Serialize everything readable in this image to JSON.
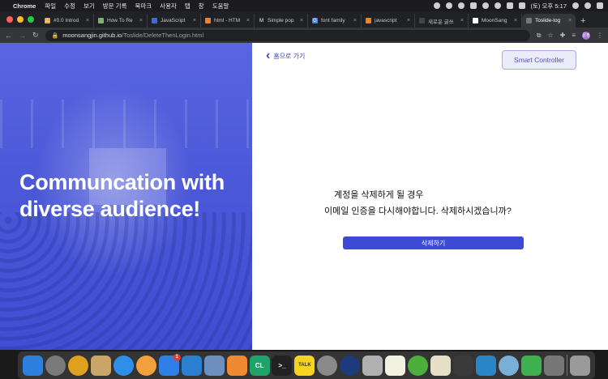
{
  "menubar": {
    "app": "Chrome",
    "items": [
      "파일",
      "수정",
      "보기",
      "방문 기록",
      "북마크",
      "사용자",
      "탭",
      "창",
      "도움말"
    ],
    "clock": "(토) 오후 5:17"
  },
  "tabs": [
    {
      "label": "#0.0 Introd",
      "color": "#f3a33a",
      "glyph": "⚠"
    },
    {
      "label": "How To Re",
      "color": "#7fb26b",
      "glyph": ""
    },
    {
      "label": "JavaScript",
      "color": "#3a6bd8",
      "glyph": ""
    },
    {
      "label": "html - HTM",
      "color": "#f48024",
      "glyph": ""
    },
    {
      "label": "Simple pop",
      "color": "#222222",
      "glyph": "M"
    },
    {
      "label": "font family",
      "color": "#4285f4",
      "glyph": "G"
    },
    {
      "label": "javascript",
      "color": "#f48024",
      "glyph": ""
    },
    {
      "label": "새로운 글쓰",
      "color": "#444444",
      "glyph": ""
    },
    {
      "label": "MoonSang",
      "color": "#ffffff",
      "glyph": ""
    },
    {
      "label": "Toslide-log",
      "color": "#777777",
      "glyph": ""
    }
  ],
  "address": {
    "host": "moonsangjin.github.io",
    "path": "/Toslide/DeleteThenLogin.html"
  },
  "profile_initials": "문정",
  "hero": {
    "title": "Communcation with diverse audience!"
  },
  "nav": {
    "back_label": "홈으로 가기",
    "smart_controller": "Smart Controller"
  },
  "message": {
    "line1": "계정을 삭제하게 될 경우",
    "line2": "이메일 인증을 다시해야합니다. 삭제하시겠습니까?"
  },
  "delete_button": "삭제하기",
  "dock": {
    "apps": [
      {
        "name": "finder-icon",
        "color": "#2d7fe0",
        "round": false
      },
      {
        "name": "launchpad-icon",
        "color": "#7a7a7a",
        "round": true
      },
      {
        "name": "chrome-icon",
        "color": "#e0a020",
        "round": true
      },
      {
        "name": "notes-icon",
        "color": "#c9a56a",
        "round": false
      },
      {
        "name": "safari-icon",
        "color": "#2f8fe8",
        "round": true
      },
      {
        "name": "photos-icon",
        "color": "#f0a03c",
        "round": true
      },
      {
        "name": "app-store-icon",
        "color": "#2f7fe8",
        "round": false,
        "badge": "1"
      },
      {
        "name": "vscode-icon",
        "color": "#2a7fd0",
        "round": false
      },
      {
        "name": "preview-icon",
        "color": "#6d8fc0",
        "round": false
      },
      {
        "name": "swift-icon",
        "color": "#f08a30",
        "round": false
      },
      {
        "name": "clion-icon",
        "color": "#1fa36b",
        "round": false,
        "glyph": "CL"
      },
      {
        "name": "terminal-icon",
        "color": "#222222",
        "round": false,
        "glyph": ">_"
      },
      {
        "name": "kakaotalk-icon",
        "color": "#f7d21e",
        "round": false,
        "glyph": "TALK"
      },
      {
        "name": "system-preferences-icon",
        "color": "#8a8a8a",
        "round": true
      },
      {
        "name": "quicktime-icon",
        "color": "#1d3a7a",
        "round": true
      },
      {
        "name": "image-capture-icon",
        "color": "#b0b0b0",
        "round": false
      },
      {
        "name": "stickies-icon",
        "color": "#f2f2e0",
        "round": false
      },
      {
        "name": "utorrent-icon",
        "color": "#4caf3c",
        "round": true
      },
      {
        "name": "books-icon",
        "color": "#e7e0c8",
        "round": false
      },
      {
        "name": "activity-monitor-icon",
        "color": "#3a3a3a",
        "round": false
      },
      {
        "name": "sourcetree-icon",
        "color": "#2a84c8",
        "round": false
      },
      {
        "name": "screenshot-icon",
        "color": "#7ab0d8",
        "round": true
      },
      {
        "name": "facetime-icon",
        "color": "#3fb050",
        "round": false
      },
      {
        "name": "stocks-icon",
        "color": "#777777",
        "round": false
      },
      {
        "name": "trash-icon",
        "color": "#9a9a9a",
        "round": false
      }
    ]
  }
}
